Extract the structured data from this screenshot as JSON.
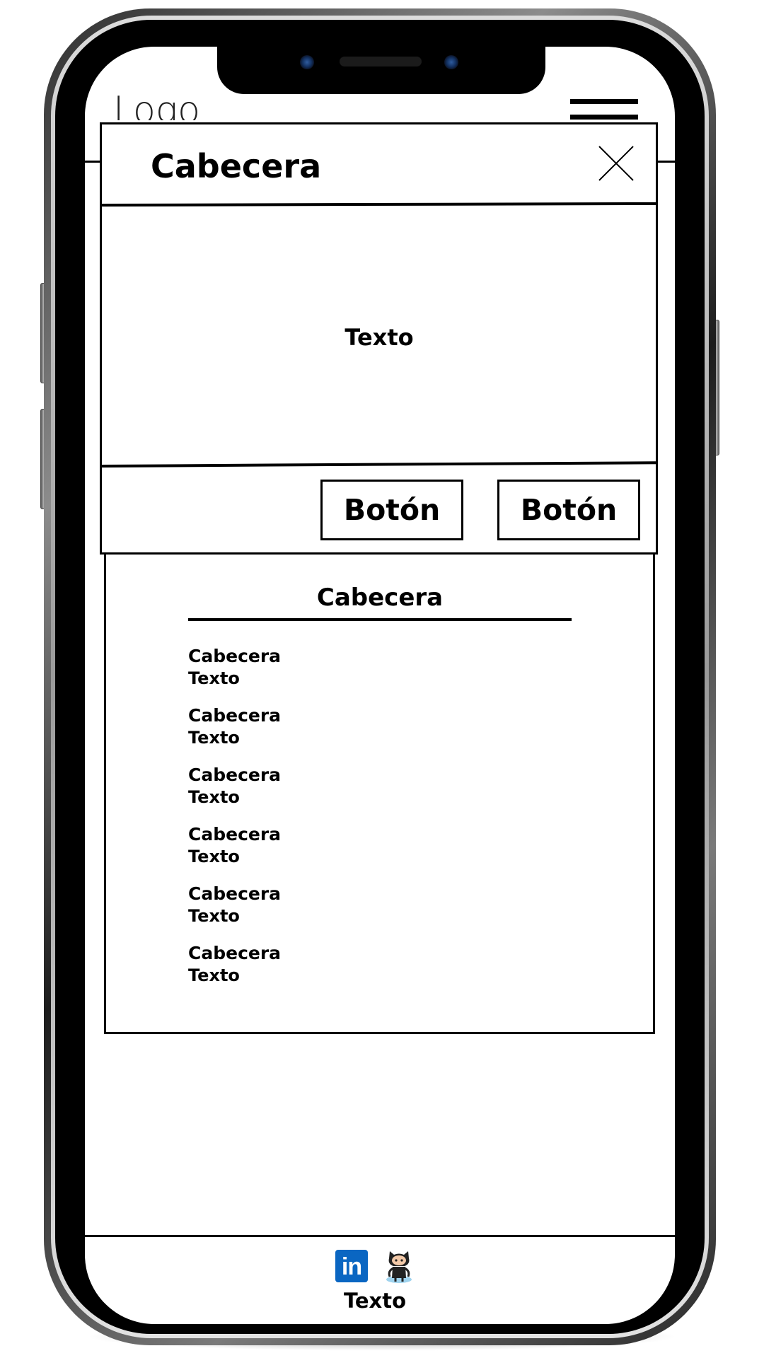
{
  "app": {
    "logo_text": "Logo",
    "menu_icon": "hamburger-menu-icon"
  },
  "modal": {
    "title": "Cabecera",
    "close_icon": "close-icon",
    "body_text": "Texto",
    "buttons": [
      {
        "label": "Botón"
      },
      {
        "label": "Botón"
      }
    ]
  },
  "content": {
    "title": "Cabecera",
    "items": [
      {
        "heading": "Cabecera",
        "text": "Texto"
      },
      {
        "heading": "Cabecera",
        "text": "Texto"
      },
      {
        "heading": "Cabecera",
        "text": "Texto"
      },
      {
        "heading": "Cabecera",
        "text": "Texto"
      },
      {
        "heading": "Cabecera",
        "text": "Texto"
      },
      {
        "heading": "Cabecera",
        "text": "Texto"
      }
    ]
  },
  "footer": {
    "icons": [
      "linkedin-icon",
      "github-icon"
    ],
    "linkedin_glyph": "in",
    "text": "Texto",
    "colors": {
      "linkedin": "#0a66c2"
    }
  }
}
